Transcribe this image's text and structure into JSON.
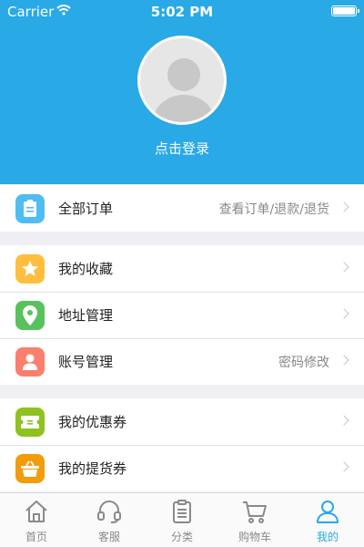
{
  "status_bar": {
    "carrier": "Carrier",
    "time": "5:02 PM"
  },
  "profile": {
    "login_label": "点击登录"
  },
  "menu_groups": [
    [
      {
        "label": "全部订单",
        "detail": "查看订单/退款/退货",
        "icon": "clipboard-icon",
        "color": "#4fbdf2"
      }
    ],
    [
      {
        "label": "我的收藏",
        "detail": "",
        "icon": "star-icon",
        "color": "#ffbe3d"
      },
      {
        "label": "地址管理",
        "detail": "",
        "icon": "location-pin-icon",
        "color": "#58c25c"
      },
      {
        "label": "账号管理",
        "detail": "密码修改",
        "icon": "user-icon",
        "color": "#fa7f6c"
      }
    ],
    [
      {
        "label": "我的优惠券",
        "detail": "",
        "icon": "ticket-icon",
        "color": "#8dc21f"
      },
      {
        "label": "我的提货券",
        "detail": "",
        "icon": "basket-icon",
        "color": "#f39c0b"
      }
    ]
  ],
  "tabbar": {
    "items": [
      {
        "label": "首页",
        "icon": "home-icon"
      },
      {
        "label": "客服",
        "icon": "headset-icon"
      },
      {
        "label": "分类",
        "icon": "clipboard-list-icon"
      },
      {
        "label": "购物车",
        "icon": "cart-icon"
      },
      {
        "label": "我的",
        "icon": "person-icon"
      }
    ],
    "active_index": 4
  }
}
